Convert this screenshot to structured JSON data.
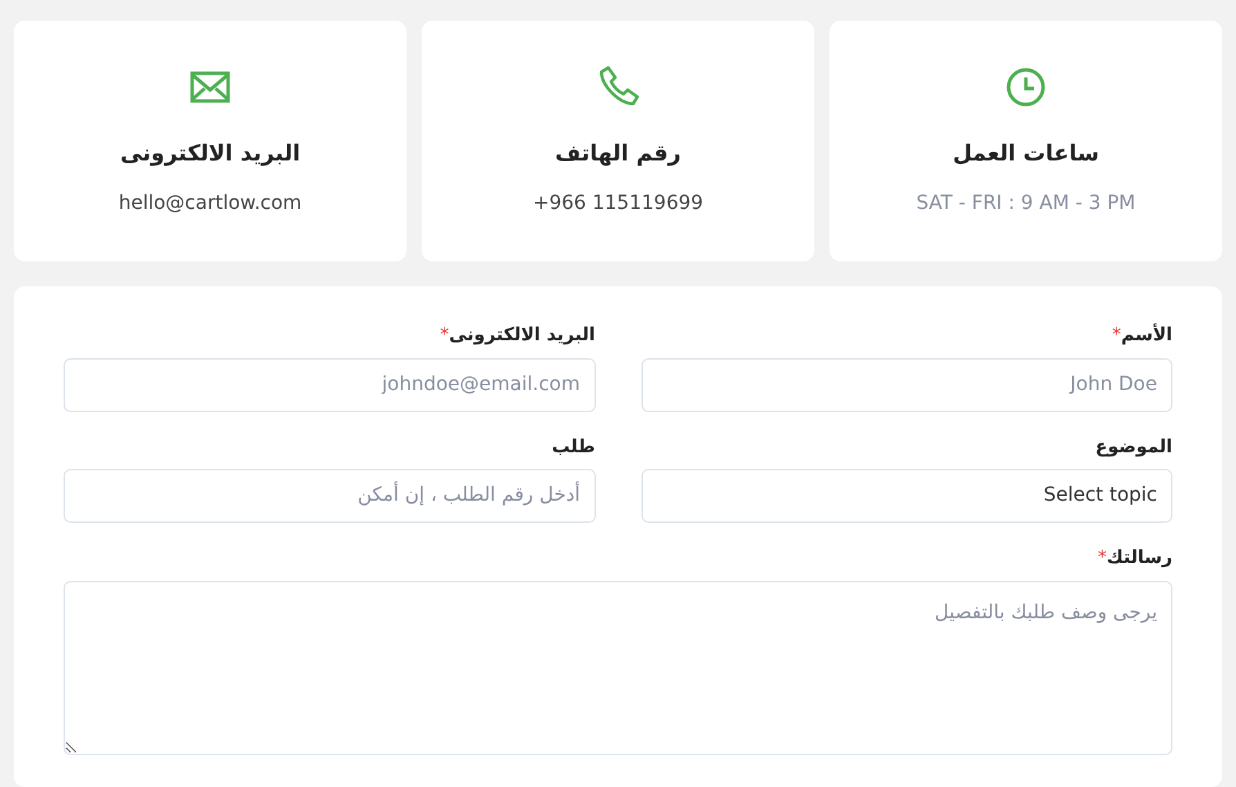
{
  "info_cards": [
    {
      "kind": "clock",
      "title": "ساعات العمل",
      "text": "SAT - FRI : 9 AM - 3 PM"
    },
    {
      "kind": "phone",
      "title": "رقم الهاتف",
      "text": "+966 115119699"
    },
    {
      "kind": "mail",
      "title": "البريد الالكترونى",
      "text": "hello@cartlow.com"
    }
  ],
  "form": {
    "fields": [
      {
        "kind": "input",
        "label": "الأسم",
        "required_mark": "*",
        "placeholder": "John Doe"
      },
      {
        "kind": "input",
        "label": "البريد الالكترونى",
        "required_mark": "*",
        "placeholder": "johndoe@email.com"
      },
      {
        "kind": "select",
        "label": "الموضوع",
        "value": "Select topic"
      },
      {
        "kind": "input",
        "label": "طلب",
        "placeholder": "أدخل رقم الطلب ، إن أمكن"
      },
      {
        "kind": "textarea",
        "label": "رسالتك",
        "required_mark": "*",
        "placeholder": "يرجى وصف طلبك بالتفصيل"
      }
    ]
  }
}
